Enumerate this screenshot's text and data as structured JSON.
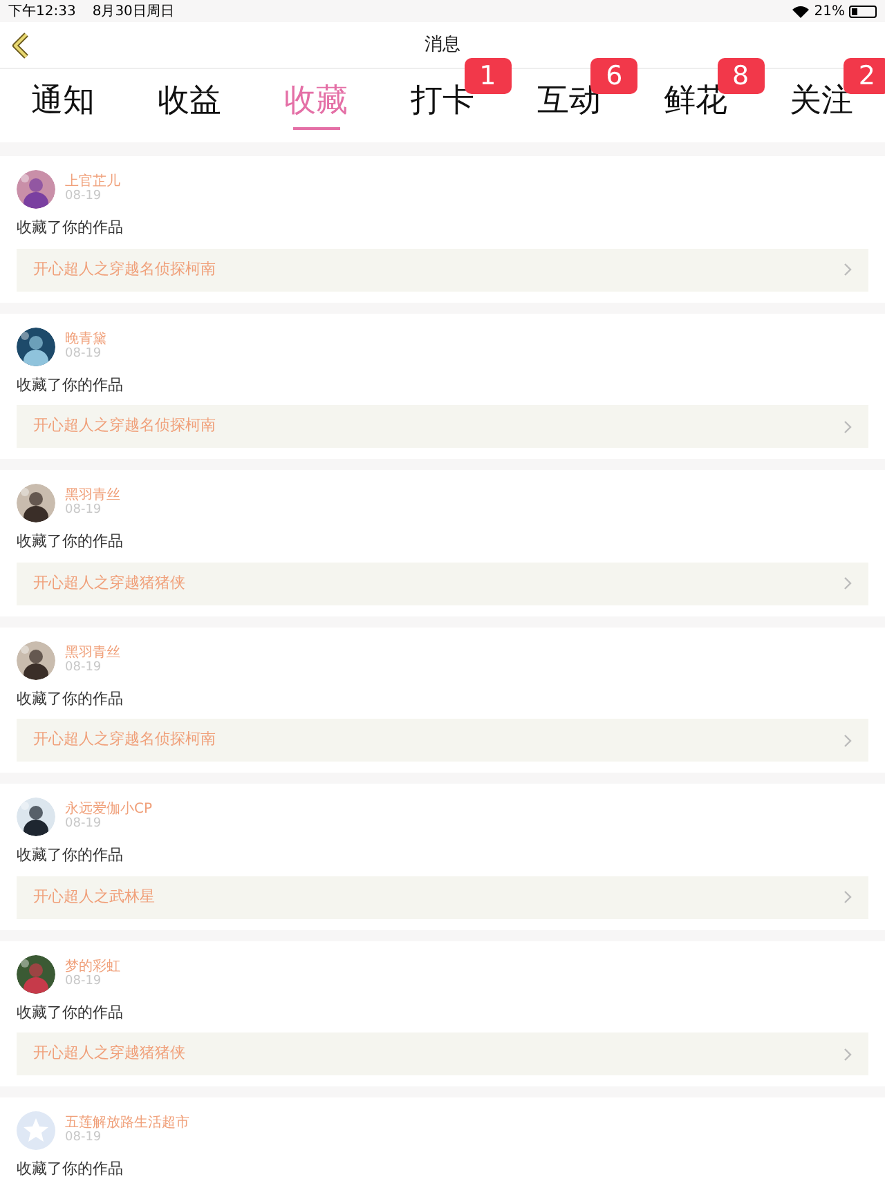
{
  "status_bar": {
    "time": "下午12:33",
    "date": "8月30日周日",
    "battery": "21%"
  },
  "nav": {
    "title": "消息"
  },
  "tabs": [
    {
      "label": "通知",
      "selected": false
    },
    {
      "label": "收益",
      "selected": false
    },
    {
      "label": "收藏",
      "selected": true
    },
    {
      "label": "打卡",
      "selected": false,
      "badge": "1"
    },
    {
      "label": "互动",
      "selected": false,
      "badge": "6"
    },
    {
      "label": "鲜花",
      "selected": false,
      "badge": "8"
    },
    {
      "label": "关注",
      "selected": false,
      "badge": "2"
    }
  ],
  "items": [
    {
      "user": "上官芷儿",
      "kind": "picture",
      "date": "08-19",
      "action": "收藏了你的作品",
      "work": "开心超人之穿越名侦探柯南"
    },
    {
      "user": "晚青黛",
      "kind": "picture",
      "date": "08-19",
      "action": "收藏了你的作品",
      "work": "开心超人之穿越名侦探柯南"
    },
    {
      "user": "黑羽青丝",
      "kind": "picture",
      "date": "08-19",
      "action": "收藏了你的作品",
      "work": "开心超人之穿越猪猪侠"
    },
    {
      "user": "黑羽青丝",
      "kind": "picture",
      "date": "08-19",
      "action": "收藏了你的作品",
      "work": "开心超人之穿越名侦探柯南"
    },
    {
      "user": "永远爱伽小CP",
      "kind": "picture",
      "date": "08-19",
      "action": "收藏了你的作品",
      "work": "开心超人之武林星"
    },
    {
      "user": "梦的彩虹",
      "kind": "picture",
      "date": "08-19",
      "action": "收藏了你的作品",
      "work": "开心超人之穿越猪猪侠"
    },
    {
      "user": "五莲解放路生活超市",
      "kind": "placeholder",
      "date": "08-19",
      "action": "收藏了你的作品"
    }
  ]
}
